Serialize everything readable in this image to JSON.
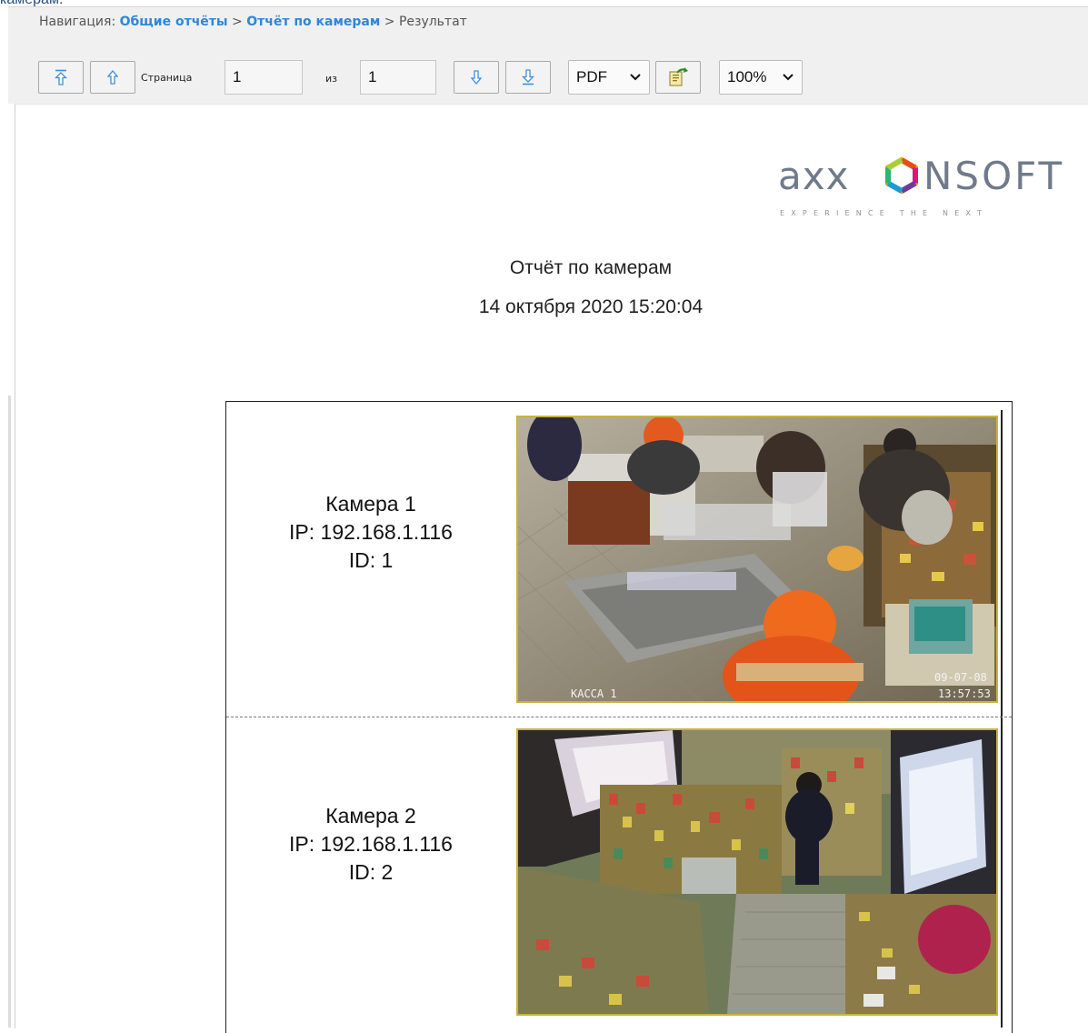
{
  "cut_text": "камерам.",
  "nav": {
    "prefix": "Навигация:",
    "link1": "Общие отчёты",
    "sep1": ">",
    "link2": "Отчёт по камерам",
    "sep2": ">",
    "current": "Результат"
  },
  "toolbar": {
    "page_label": "Страница",
    "page_value": "1",
    "of_label": "из",
    "total_value": "1",
    "format_value": "PDF",
    "zoom_value": "100%"
  },
  "logo": {
    "brand_left": "axx",
    "brand_right": "nsoft",
    "tagline": "EXPERIENCE THE NEXT"
  },
  "report": {
    "title": "Отчёт по камерам",
    "datetime": "14 октября 2020 15:20:04"
  },
  "cameras": [
    {
      "name": "Камера 1",
      "ip": "IP: 192.168.1.116",
      "id": "ID: 1",
      "overlay_label": "KACCA 1",
      "overlay_date": "09-07-08",
      "overlay_time": "13:57:53"
    },
    {
      "name": "Камера 2",
      "ip": "IP: 192.168.1.116",
      "id": "ID: 2"
    }
  ]
}
